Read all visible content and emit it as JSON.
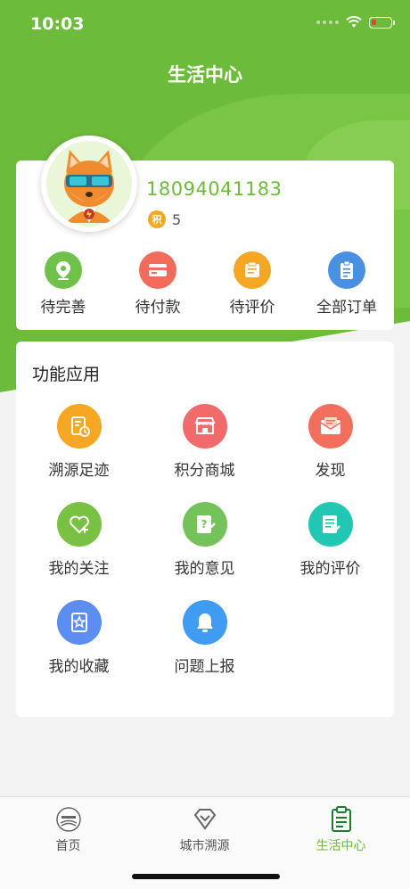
{
  "status_bar": {
    "time": "10:03"
  },
  "header": {
    "title": "生活中心"
  },
  "profile": {
    "phone": "18094041183",
    "points_badge": "积",
    "points_value": "5"
  },
  "orders": [
    {
      "label": "待完善",
      "icon": "location-pin-icon",
      "color": "#6ec24a"
    },
    {
      "label": "待付款",
      "icon": "card-icon",
      "color": "#f26b5b"
    },
    {
      "label": "待评价",
      "icon": "review-icon",
      "color": "#f5a623"
    },
    {
      "label": "全部订单",
      "icon": "clipboard-icon",
      "color": "#4a90e2"
    }
  ],
  "functions": {
    "title": "功能应用",
    "items": [
      {
        "label": "溯源足迹",
        "icon": "trace-footprint-icon",
        "color": "#f5a623"
      },
      {
        "label": "积分商城",
        "icon": "store-icon",
        "color": "#f26b6b"
      },
      {
        "label": "发现",
        "icon": "envelope-icon",
        "color": "#f2705b"
      },
      {
        "label": "我的关注",
        "icon": "heart-plus-icon",
        "color": "#79c143"
      },
      {
        "label": "我的意见",
        "icon": "feedback-icon",
        "color": "#74c25a"
      },
      {
        "label": "我的评价",
        "icon": "note-icon",
        "color": "#22c7b4"
      },
      {
        "label": "我的收藏",
        "icon": "star-bookmark-icon",
        "color": "#5b8ef0"
      },
      {
        "label": "问题上报",
        "icon": "bell-icon",
        "color": "#3f9cf0"
      }
    ]
  },
  "tabbar": {
    "tabs": [
      {
        "label": "首页",
        "icon": "home-logo-icon"
      },
      {
        "label": "城市溯源",
        "icon": "diamond-icon"
      },
      {
        "label": "生活中心",
        "icon": "clipboard-list-icon",
        "active": true
      }
    ],
    "active_color": "#6dbb3a"
  }
}
